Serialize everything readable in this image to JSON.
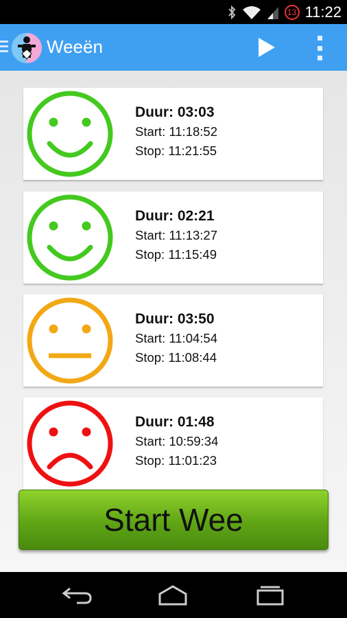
{
  "status": {
    "time": "11:22",
    "notification_count": "13"
  },
  "actionbar": {
    "title": "Weeën"
  },
  "contractions": [
    {
      "mood": "happy",
      "color": "#44c91f",
      "duration_label": "Duur: 03:03",
      "start_label": "Start: 11:18:52",
      "stop_label": "Stop: 11:21:55"
    },
    {
      "mood": "happy",
      "color": "#44c91f",
      "duration_label": "Duur: 02:21",
      "start_label": "Start: 11:13:27",
      "stop_label": "Stop: 11:15:49"
    },
    {
      "mood": "neutral",
      "color": "#f2a815",
      "duration_label": "Duur: 03:50",
      "start_label": "Start: 11:04:54",
      "stop_label": "Stop: 11:08:44"
    },
    {
      "mood": "sad",
      "color": "#ee1111",
      "duration_label": "Duur: 01:48",
      "start_label": "Start: 10:59:34",
      "stop_label": "Stop: 11:01:23"
    }
  ],
  "start_button": {
    "label": "Start Wee"
  }
}
